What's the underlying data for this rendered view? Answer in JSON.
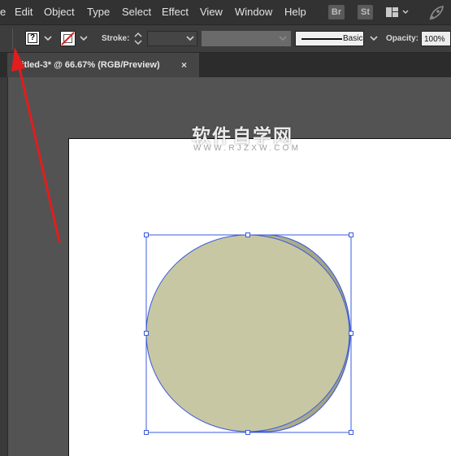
{
  "menu": {
    "items": [
      {
        "label": "e"
      },
      {
        "label": "Edit"
      },
      {
        "label": "Object"
      },
      {
        "label": "Type"
      },
      {
        "label": "Select"
      },
      {
        "label": "Effect"
      },
      {
        "label": "View"
      },
      {
        "label": "Window"
      },
      {
        "label": "Help"
      }
    ],
    "bridge_badge": "Br",
    "stock_badge": "St",
    "workspace_switcher_icon": "grid-layout-icon",
    "gpu_icon": "rocket-icon"
  },
  "control_bar": {
    "fill_swatch_mark": "?",
    "stroke_label": "Stroke:",
    "stroke_weight": "",
    "brush_name": "Basic",
    "opacity_label": "Opacity:",
    "opacity_value": "100%"
  },
  "document_tab": {
    "title": "ntitled-3* @ 66.67% (RGB/Preview)",
    "close_glyph": "×"
  },
  "watermark": {
    "title": "软件自学网",
    "url": "WWW.RJZXW.COM"
  },
  "colors": {
    "circle_fill": "#c7c7a3",
    "circle_side": "#a4a485",
    "selection": "#3b5bdb",
    "annotation_arrow": "#e11d1d"
  }
}
